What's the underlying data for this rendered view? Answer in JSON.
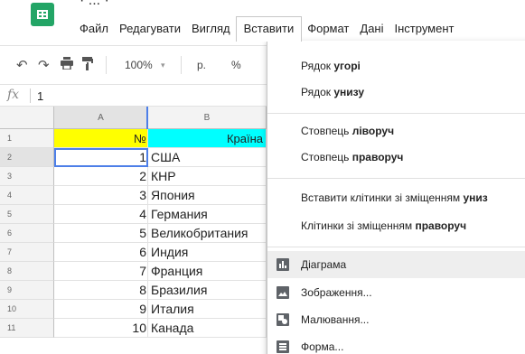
{
  "window": {
    "title_fragment": "· ... ·"
  },
  "menubar": {
    "items": [
      "Файл",
      "Редагувати",
      "Вигляд",
      "Вставити",
      "Формат",
      "Дані",
      "Інструмент"
    ],
    "active": "Вставити"
  },
  "toolbar": {
    "zoom": "100%",
    "zoom_arrow": "▾",
    "currency": "р.",
    "percent": "%"
  },
  "formula_bar": {
    "fx_label": "fx",
    "value": "1"
  },
  "grid": {
    "columns": [
      "A",
      "B"
    ],
    "rows": [
      {
        "n": "1",
        "a": "№",
        "b": "Країна"
      },
      {
        "n": "2",
        "a": "1",
        "b": "США"
      },
      {
        "n": "3",
        "a": "2",
        "b": "КНР"
      },
      {
        "n": "4",
        "a": "3",
        "b": "Япония"
      },
      {
        "n": "5",
        "a": "4",
        "b": "Германия"
      },
      {
        "n": "6",
        "a": "5",
        "b": "Великобритания"
      },
      {
        "n": "7",
        "a": "6",
        "b": "Индия"
      },
      {
        "n": "8",
        "a": "7",
        "b": "Франция"
      },
      {
        "n": "9",
        "a": "8",
        "b": "Бразилия"
      },
      {
        "n": "10",
        "a": "9",
        "b": "Италия"
      },
      {
        "n": "11",
        "a": "10",
        "b": "Канада"
      }
    ],
    "header_colors": {
      "a": "#ffff00",
      "b": "#00ffff"
    }
  },
  "insert_menu": {
    "row_above": {
      "prefix": "Рядок ",
      "bold": "угорі"
    },
    "row_below": {
      "prefix": "Рядок ",
      "bold": "унизу"
    },
    "col_left": {
      "prefix": "Стовпець ",
      "bold": "ліворуч"
    },
    "col_right": {
      "prefix": "Стовпець ",
      "bold": "праворуч"
    },
    "cells_down": {
      "prefix": "Вставити клітинки зі зміщенням ",
      "bold": "униз"
    },
    "cells_right": {
      "prefix": "Клітинки зі зміщенням ",
      "bold": "праворуч"
    },
    "chart": "Діаграма",
    "image": "Зображення...",
    "drawing": "Малювання...",
    "form": "Форма..."
  },
  "colors": {
    "selection": "#4d7fe8",
    "logo": "#23a566"
  }
}
